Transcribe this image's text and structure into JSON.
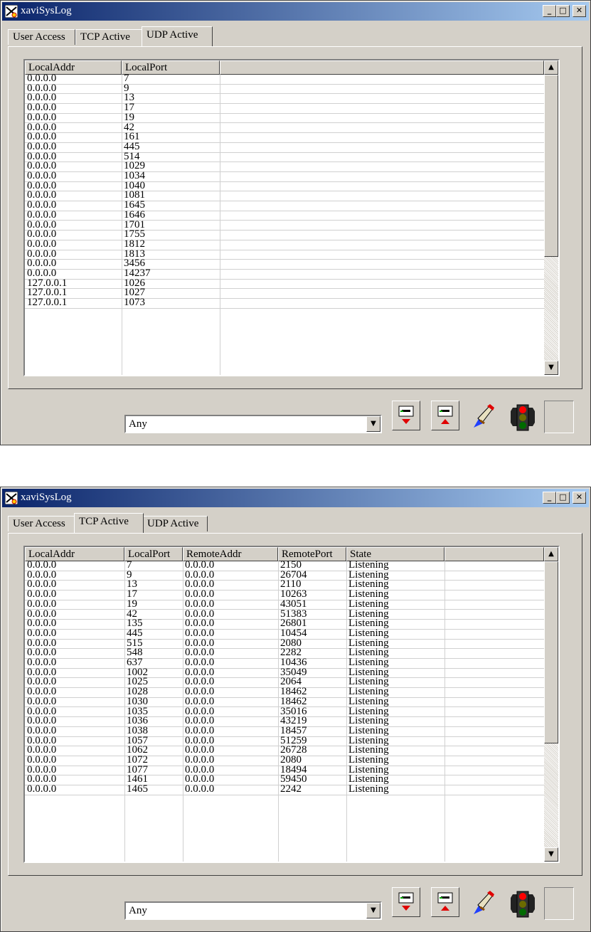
{
  "window_title": "xaviSysLog",
  "title_buttons": {
    "minimize": "_",
    "maximize": "□",
    "close": "✕"
  },
  "tabs": [
    "User Access",
    "TCP Active",
    "UDP Active"
  ],
  "filter": {
    "value": "Any"
  },
  "icons": [
    "scroll-down-icon",
    "scroll-up-icon",
    "paintbrush-icon",
    "traffic-light-icon"
  ],
  "udp_window": {
    "active_tab": "UDP Active",
    "columns": [
      "LocalAddr",
      "LocalPort"
    ],
    "rows": [
      [
        "0.0.0.0",
        "7"
      ],
      [
        "0.0.0.0",
        "9"
      ],
      [
        "0.0.0.0",
        "13"
      ],
      [
        "0.0.0.0",
        "17"
      ],
      [
        "0.0.0.0",
        "19"
      ],
      [
        "0.0.0.0",
        "42"
      ],
      [
        "0.0.0.0",
        "161"
      ],
      [
        "0.0.0.0",
        "445"
      ],
      [
        "0.0.0.0",
        "514"
      ],
      [
        "0.0.0.0",
        "1029"
      ],
      [
        "0.0.0.0",
        "1034"
      ],
      [
        "0.0.0.0",
        "1040"
      ],
      [
        "0.0.0.0",
        "1081"
      ],
      [
        "0.0.0.0",
        "1645"
      ],
      [
        "0.0.0.0",
        "1646"
      ],
      [
        "0.0.0.0",
        "1701"
      ],
      [
        "0.0.0.0",
        "1755"
      ],
      [
        "0.0.0.0",
        "1812"
      ],
      [
        "0.0.0.0",
        "1813"
      ],
      [
        "0.0.0.0",
        "3456"
      ],
      [
        "0.0.0.0",
        "14237"
      ],
      [
        "127.0.0.1",
        "1026"
      ],
      [
        "127.0.0.1",
        "1027"
      ],
      [
        "127.0.0.1",
        "1073"
      ]
    ]
  },
  "tcp_window": {
    "active_tab": "TCP Active",
    "columns": [
      "LocalAddr",
      "LocalPort",
      "RemoteAddr",
      "RemotePort",
      "State"
    ],
    "rows": [
      [
        "0.0.0.0",
        "7",
        "0.0.0.0",
        "2150",
        "Listening"
      ],
      [
        "0.0.0.0",
        "9",
        "0.0.0.0",
        "26704",
        "Listening"
      ],
      [
        "0.0.0.0",
        "13",
        "0.0.0.0",
        "2110",
        "Listening"
      ],
      [
        "0.0.0.0",
        "17",
        "0.0.0.0",
        "10263",
        "Listening"
      ],
      [
        "0.0.0.0",
        "19",
        "0.0.0.0",
        "43051",
        "Listening"
      ],
      [
        "0.0.0.0",
        "42",
        "0.0.0.0",
        "51383",
        "Listening"
      ],
      [
        "0.0.0.0",
        "135",
        "0.0.0.0",
        "26801",
        "Listening"
      ],
      [
        "0.0.0.0",
        "445",
        "0.0.0.0",
        "10454",
        "Listening"
      ],
      [
        "0.0.0.0",
        "515",
        "0.0.0.0",
        "2080",
        "Listening"
      ],
      [
        "0.0.0.0",
        "548",
        "0.0.0.0",
        "2282",
        "Listening"
      ],
      [
        "0.0.0.0",
        "637",
        "0.0.0.0",
        "10436",
        "Listening"
      ],
      [
        "0.0.0.0",
        "1002",
        "0.0.0.0",
        "35049",
        "Listening"
      ],
      [
        "0.0.0.0",
        "1025",
        "0.0.0.0",
        "2064",
        "Listening"
      ],
      [
        "0.0.0.0",
        "1028",
        "0.0.0.0",
        "18462",
        "Listening"
      ],
      [
        "0.0.0.0",
        "1030",
        "0.0.0.0",
        "18462",
        "Listening"
      ],
      [
        "0.0.0.0",
        "1035",
        "0.0.0.0",
        "35016",
        "Listening"
      ],
      [
        "0.0.0.0",
        "1036",
        "0.0.0.0",
        "43219",
        "Listening"
      ],
      [
        "0.0.0.0",
        "1038",
        "0.0.0.0",
        "18457",
        "Listening"
      ],
      [
        "0.0.0.0",
        "1057",
        "0.0.0.0",
        "51259",
        "Listening"
      ],
      [
        "0.0.0.0",
        "1062",
        "0.0.0.0",
        "26728",
        "Listening"
      ],
      [
        "0.0.0.0",
        "1072",
        "0.0.0.0",
        "2080",
        "Listening"
      ],
      [
        "0.0.0.0",
        "1077",
        "0.0.0.0",
        "18494",
        "Listening"
      ],
      [
        "0.0.0.0",
        "1461",
        "0.0.0.0",
        "59450",
        "Listening"
      ],
      [
        "0.0.0.0",
        "1465",
        "0.0.0.0",
        "2242",
        "Listening"
      ]
    ]
  }
}
